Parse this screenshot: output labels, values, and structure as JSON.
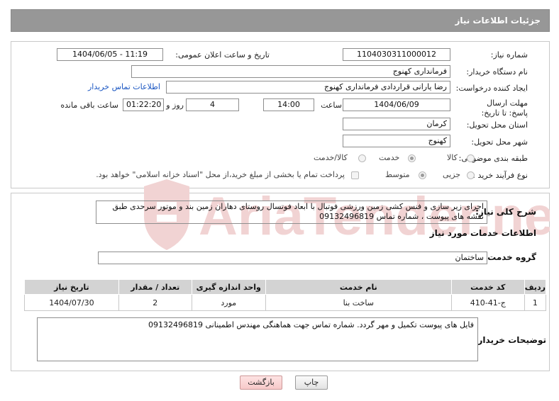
{
  "page": {
    "title": "جزئیات اطلاعات نیاز"
  },
  "need_info": {
    "need_number_label": "شماره نیاز:",
    "need_number": "1104030311000012",
    "announce_label": "تاریخ و ساعت اعلان عمومی:",
    "announce_value": "1404/06/05 - 11:19",
    "buyer_org_label": "نام دستگاه خریدار:",
    "buyer_org": "فرمانداری کهنوج",
    "creator_label": "ایجاد کننده درخواست:",
    "creator": "رضا  یارانی قراردادی فرمانداری کهنوج",
    "contact_link": "اطلاعات تماس خریدار",
    "deadline_label": "مهلت ارسال پاسخ: تا تاریخ:",
    "deadline_date": "1404/06/09",
    "time_label": "ساعت",
    "deadline_time": "14:00",
    "days_value": "4",
    "days_label": "روز و",
    "remaining_time": "01:22:20",
    "remaining_label": "ساعت باقی مانده",
    "province_label": "استان محل تحویل:",
    "province": "کرمان",
    "city_label": "شهر محل تحویل:",
    "city": "کهنوج",
    "category_label": "طبقه بندی موضوعی:",
    "category_options": [
      "کالا",
      "خدمت",
      "کالا/خدمت"
    ],
    "category_selected": "خدمت",
    "process_label": "نوع فرآیند خرید :",
    "process_options": [
      "جزیی",
      "متوسط"
    ],
    "process_selected": "متوسط",
    "treasury_note": "پرداخت تمام یا بخشی از مبلغ خرید،از محل \"اسناد خزانه اسلامی\" خواهد بود."
  },
  "description": {
    "label": "شرح کلی نیاز:",
    "text": "اجرای زیر سازی و فنس کشی زمین ورزشی فوتبال با ابعاد فوتسال روستای دهاران زمین بند و موتور سرحدی طبق نقشه های پیوست ، شماره تماس  09132496819"
  },
  "services": {
    "section_title": "اطلاعات خدمات مورد نیاز",
    "group_label": "گروه خدمت:",
    "group_value": "ساختمان",
    "columns": [
      "ردیف",
      "کد خدمت",
      "نام خدمت",
      "واحد اندازه گیری",
      "تعداد / مقدار",
      "تاریخ نیاز"
    ],
    "rows": [
      [
        "1",
        "ج-41-410",
        "ساخت بنا",
        "مورد",
        "2",
        "1404/07/30"
      ]
    ]
  },
  "buyer_notes": {
    "label": "توضیحات خریدار:",
    "text": "فایل های پیوست تکمیل و مهر گردد. شماره تماس جهت هماهنگی مهندس اطمینانی 09132496819"
  },
  "buttons": {
    "print": "چاپ",
    "back": "بازگشت"
  },
  "watermark": {
    "text": "AriaTender.net"
  },
  "colors": {
    "header_bg": "#979797",
    "link": "#1a56c2",
    "watermark": "#e8b9b9"
  }
}
